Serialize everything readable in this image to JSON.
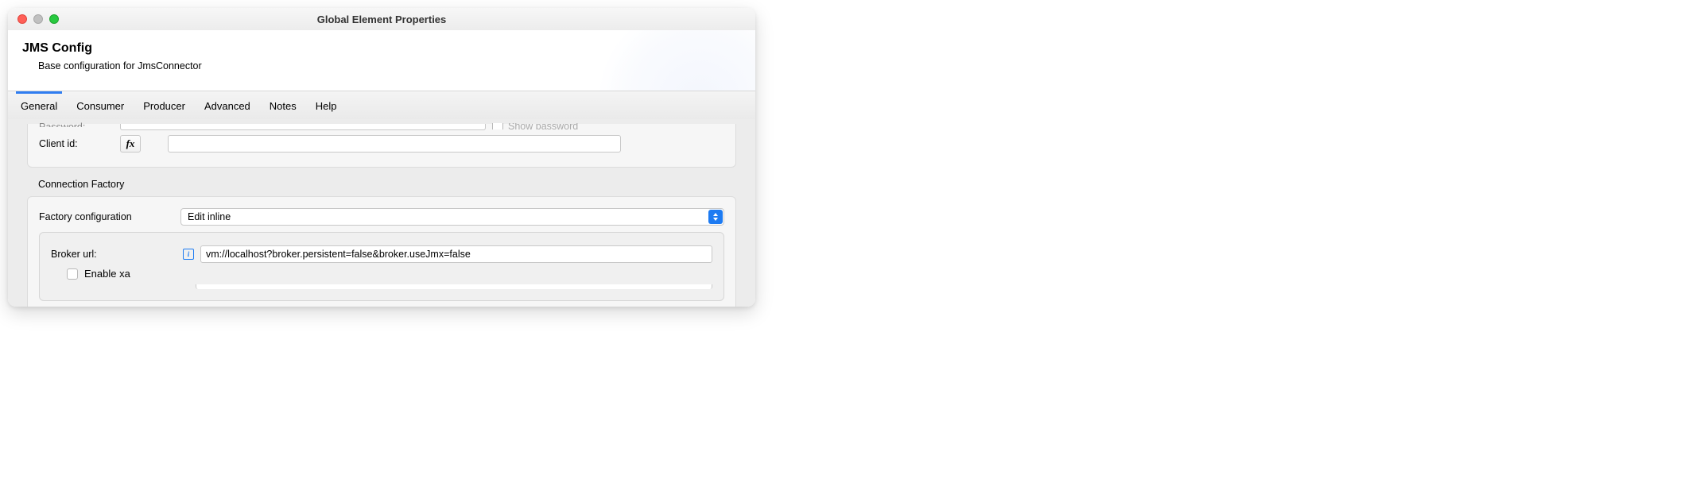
{
  "window": {
    "title": "Global Element Properties"
  },
  "header": {
    "title": "JMS Config",
    "subtitle": "Base configuration for JmsConnector"
  },
  "tabs": [
    {
      "label": "General",
      "active": true
    },
    {
      "label": "Consumer",
      "active": false
    },
    {
      "label": "Producer",
      "active": false
    },
    {
      "label": "Advanced",
      "active": false
    },
    {
      "label": "Notes",
      "active": false
    },
    {
      "label": "Help",
      "active": false
    }
  ],
  "form": {
    "password_label": "Password:",
    "password_value": "",
    "show_password_label": "Show password",
    "client_id_label": "Client id:",
    "client_id_value": "",
    "fx_label": "fx",
    "connection_factory_label": "Connection Factory",
    "factory_config_label": "Factory configuration",
    "factory_config_value": "Edit inline",
    "broker_url_label": "Broker url:",
    "broker_url_value": "vm://localhost?broker.persistent=false&broker.useJmx=false",
    "enable_xa_label": "Enable xa",
    "info_glyph": "i"
  }
}
